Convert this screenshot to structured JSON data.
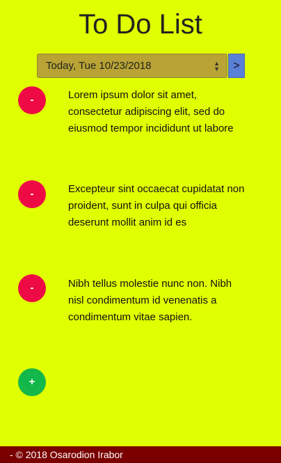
{
  "header": {
    "title": "To Do List"
  },
  "date_selector": {
    "selected": "Today, Tue 10/23/2018",
    "next_label": ">"
  },
  "tasks": [
    {
      "remove_label": "-",
      "text": "Lorem ipsum dolor sit amet, consectetur adipiscing elit, sed do eiusmod tempor incididunt ut labore"
    },
    {
      "remove_label": "-",
      "text": "Excepteur sint occaecat cupidatat non proident, sunt in culpa qui officia deserunt mollit anim id es"
    },
    {
      "remove_label": "-",
      "text": "Nibh tellus molestie nunc non. Nibh nisl condimentum id venenatis a condimentum vitae sapien."
    }
  ],
  "add_button": {
    "label": "+"
  },
  "footer": {
    "text": "- © 2018 Osarodion Irabor"
  },
  "colors": {
    "background": "#e0ff00",
    "remove_button": "#ee0a44",
    "add_button": "#14b74a",
    "footer": "#7a0000",
    "select": "#b8a334",
    "next_button": "#5a7fd6"
  }
}
